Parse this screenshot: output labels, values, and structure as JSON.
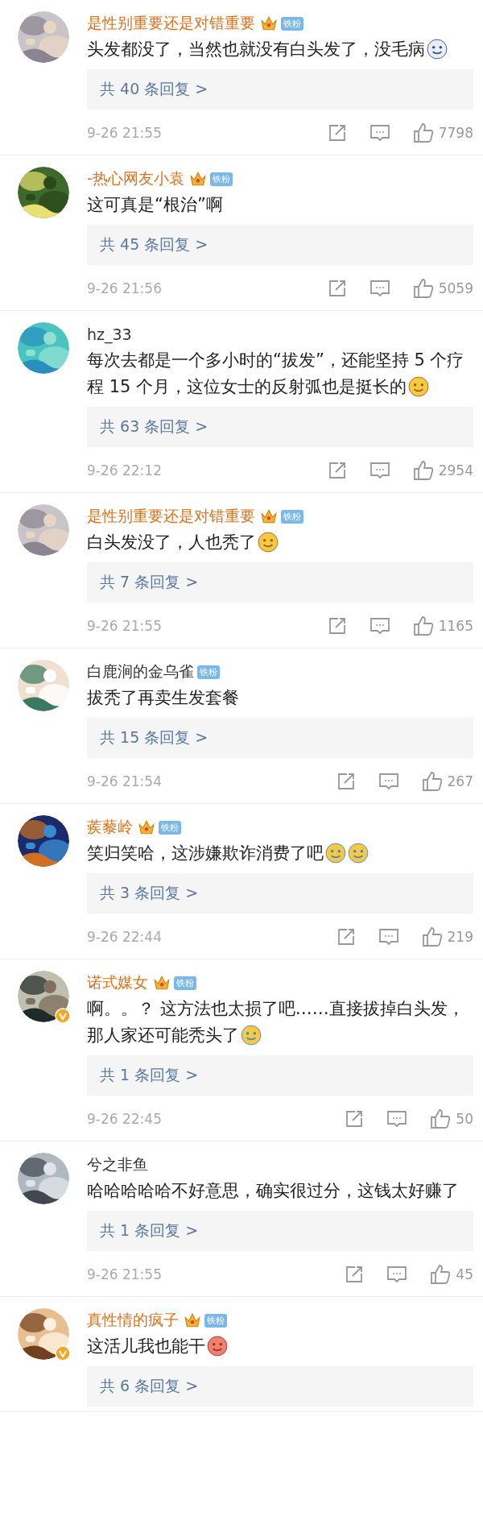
{
  "comments": [
    {
      "name": "是性别重要还是对错重要",
      "vip": true,
      "crown": true,
      "fan_badge": "铁粉",
      "verified": false,
      "text": "头发都没了，当然也就没有白头发了，没毛病",
      "emojis": [
        {
          "kind": "husky"
        }
      ],
      "replies": "共 40 条回复 >",
      "time": "9-26 21:55",
      "likes": "7798"
    },
    {
      "name": "-热心网友小袁",
      "vip": true,
      "crown": true,
      "fan_badge": "铁粉",
      "verified": false,
      "text": "这可真是“根治”啊",
      "replies": "共 45 条回复 >",
      "time": "9-26 21:56",
      "likes": "5059"
    },
    {
      "name": "hz_33",
      "vip": false,
      "crown": false,
      "verified": false,
      "text": "每次去都是一个多小时的“拔发”，还能坚持 5 个疗程 15 个月，这位女士的反射弧也是挺长的",
      "emojis": [
        {
          "kind": "shy"
        }
      ],
      "replies": "共 63 条回复 >",
      "time": "9-26 22:12",
      "likes": "2954"
    },
    {
      "name": "是性别重要还是对错重要",
      "vip": true,
      "crown": true,
      "fan_badge": "铁粉",
      "verified": false,
      "text": "白头发没了，人也秃了",
      "emojis": [
        {
          "kind": "grin"
        }
      ],
      "replies": "共 7 条回复 >",
      "time": "9-26 21:55",
      "likes": "1165"
    },
    {
      "name": "白鹿涧的金乌雀",
      "vip": false,
      "crown": false,
      "fan_badge": "铁粉",
      "verified": false,
      "text": "拔秃了再卖生发套餐",
      "replies": "共 15 条回复 >",
      "time": "9-26 21:54",
      "likes": "267"
    },
    {
      "name": "蒺藜岭",
      "vip": true,
      "crown": true,
      "fan_badge": "铁粉",
      "verified": false,
      "text": "笑归笑哈，这涉嫌欺诈消费了吧",
      "emojis": [
        {
          "kind": "cry"
        },
        {
          "kind": "cry"
        }
      ],
      "replies": "共 3 条回复 >",
      "time": "9-26 22:44",
      "likes": "219"
    },
    {
      "name": "诺式媒女",
      "vip": true,
      "crown": true,
      "fan_badge": "铁粉",
      "verified": true,
      "text": "啊。。？ 这方法也太损了吧……直接拔掉白头发，那人家还可能秃头了",
      "emojis": [
        {
          "kind": "laugh-cry"
        }
      ],
      "replies": "共 1 条回复 >",
      "time": "9-26 22:45",
      "likes": "50"
    },
    {
      "name": "兮之非鱼",
      "vip": false,
      "crown": false,
      "verified": false,
      "text": "哈哈哈哈哈不好意思，确实很过分，这钱太好赚了",
      "replies": "共 1 条回复 >",
      "time": "9-26 21:55",
      "likes": "45"
    },
    {
      "name": "真性情的疯子",
      "vip": true,
      "crown": true,
      "fan_badge": "铁粉",
      "verified": true,
      "text": "这活儿我也能干",
      "emojis": [
        {
          "kind": "octopus"
        }
      ],
      "replies": "共 6 条回复 >"
    }
  ]
}
